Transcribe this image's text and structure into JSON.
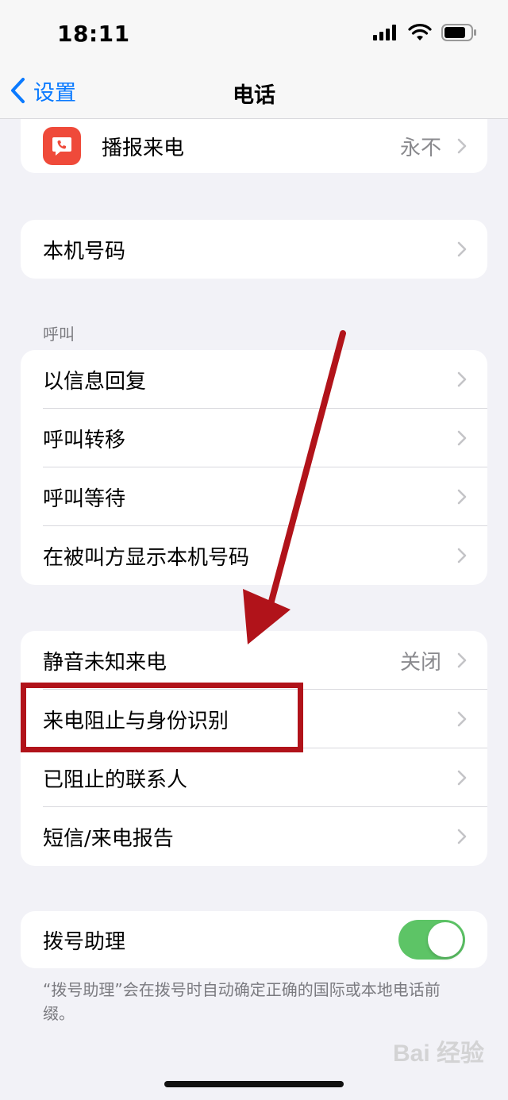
{
  "status": {
    "time": "18:11"
  },
  "nav": {
    "back_label": "设置",
    "title": "电话"
  },
  "group_top": {
    "announce_label": "播报来电",
    "announce_value": "永不"
  },
  "group_number": {
    "my_number_label": "本机号码"
  },
  "calls_section": {
    "header": "呼叫",
    "items": [
      {
        "label": "以信息回复"
      },
      {
        "label": "呼叫转移"
      },
      {
        "label": "呼叫等待"
      },
      {
        "label": "在被叫方显示本机号码"
      }
    ]
  },
  "blocking_section": {
    "items": [
      {
        "label": "静音未知来电",
        "value": "关闭"
      },
      {
        "label": "来电阻止与身份识别"
      },
      {
        "label": "已阻止的联系人"
      },
      {
        "label": "短信/来电报告"
      }
    ]
  },
  "dial_assist": {
    "label": "拨号助理",
    "enabled": true,
    "note": "“拨号助理”会在拨号时自动确定正确的国际或本地电话前缀。"
  },
  "watermark": {
    "text": "Bai 经验"
  },
  "colors": {
    "accent": "#0a7aff",
    "toggle_on": "#5dc466",
    "annotation": "#b1131a",
    "app_icon": "#ef4a3a"
  }
}
